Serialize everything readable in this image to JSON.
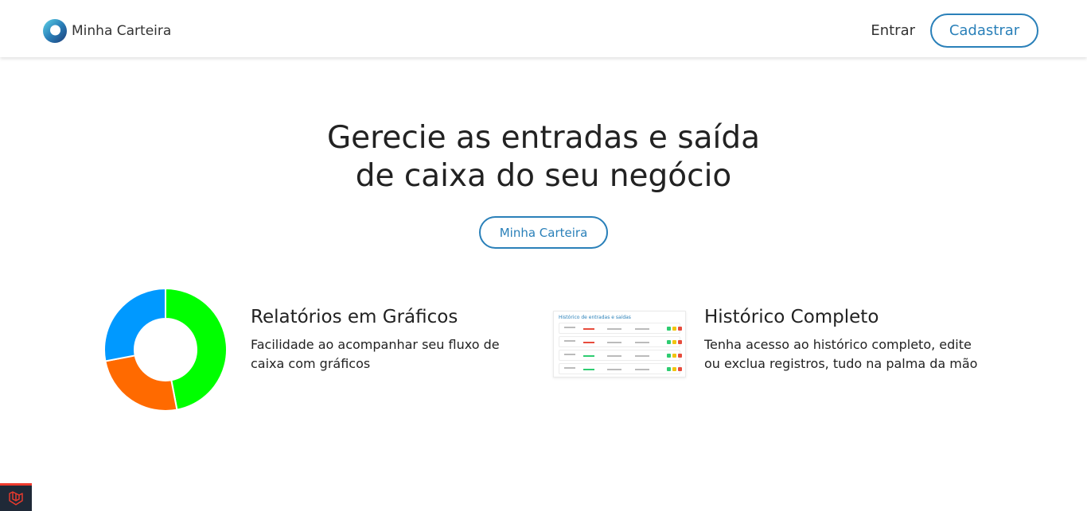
{
  "header": {
    "brand_name": "Minha Carteira",
    "login_label": "Entrar",
    "signup_label": "Cadastrar"
  },
  "hero": {
    "title_line1": "Gerecie as entradas e saída",
    "title_line2": "de caixa do seu negócio",
    "cta_label": "Minha Carteira"
  },
  "features": [
    {
      "title": "Relatórios em Gráficos",
      "description": "Facilidade ao acompanhar seu fluxo de caixa com gráficos",
      "icon": "donut-chart-icon"
    },
    {
      "title": "Histórico Completo",
      "description": "Tenha acesso ao histórico completo, edite ou exclua registros, tudo na palma da mão",
      "icon": "history-table-thumbnail"
    }
  ],
  "chart_data": {
    "type": "pie",
    "categories": [
      "",
      "",
      ""
    ],
    "values": [
      47,
      25,
      28
    ],
    "colors": [
      "#00ff00",
      "#ff6a00",
      "#0099ff"
    ],
    "donut": true
  },
  "history_thumbnail": {
    "title": "Histórico de entradas e saídas"
  },
  "colors": {
    "accent": "#2a80b9",
    "text": "#222222",
    "badge_bg": "#1f2937",
    "badge_accent": "#ef3b2d"
  },
  "badge": {
    "icon": "laravel-icon"
  }
}
